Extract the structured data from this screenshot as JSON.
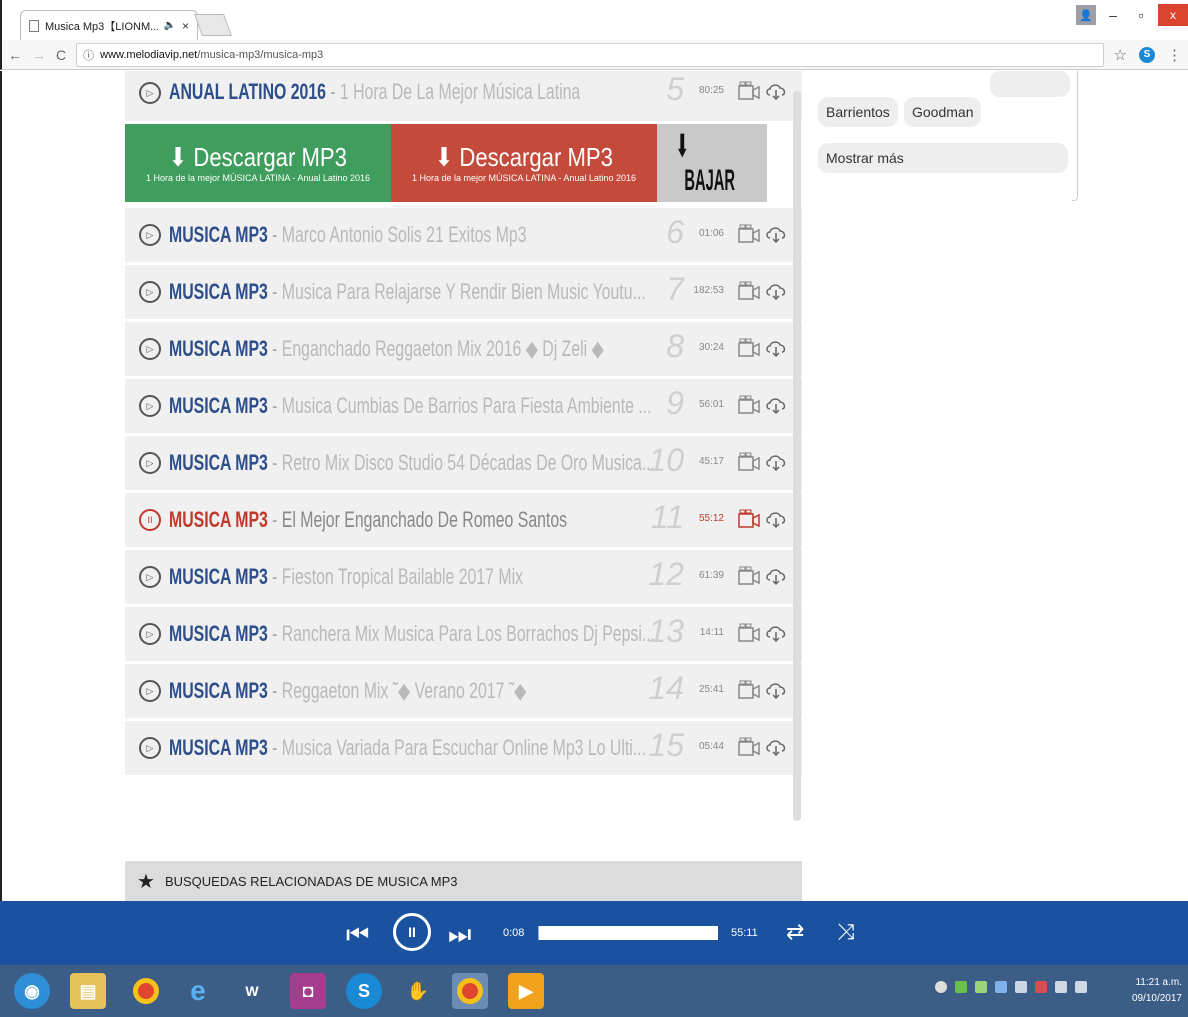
{
  "browser": {
    "tab_title": "Musica Mp3【LIONM...",
    "tab_audio_icon": "speaker-icon",
    "url_domain": "www.melodiavip.net",
    "url_path": "/musica-mp3/musica-mp3"
  },
  "tracks": [
    {
      "artist": "ANUAL LATINO 2016",
      "title": "1 Hora De La Mejor Música Latina",
      "num": "5",
      "duration": "80:25",
      "active": false
    },
    {
      "artist": "MUSICA MP3",
      "title": "Marco Antonio Solis 21 Exitos Mp3",
      "num": "6",
      "duration": "01:06",
      "active": false
    },
    {
      "artist": "MUSICA MP3",
      "title": "Musica Para Relajarse Y Rendir Bien Music Youtu...",
      "num": "7",
      "duration": "182:53",
      "active": false
    },
    {
      "artist": "MUSICA MP3",
      "title": "Enganchado Reggaeton Mix 2016 ◆ Dj Zeli ◆",
      "num": "8",
      "duration": "30:24",
      "active": false
    },
    {
      "artist": "MUSICA MP3",
      "title": "Musica Cumbias De Barrios Para Fiesta Ambiente ...",
      "num": "9",
      "duration": "56:01",
      "active": false
    },
    {
      "artist": "MUSICA MP3",
      "title": "Retro Mix Disco Studio 54 Décadas De Oro Musica...",
      "num": "10",
      "duration": "45:17",
      "active": false
    },
    {
      "artist": "MUSICA MP3",
      "title": "El Mejor Enganchado De Romeo Santos",
      "num": "11",
      "duration": "55:12",
      "active": true
    },
    {
      "artist": "MUSICA MP3",
      "title": "Fieston Tropical Bailable 2017 Mix",
      "num": "12",
      "duration": "61:39",
      "active": false
    },
    {
      "artist": "MUSICA MP3",
      "title": "Ranchera Mix Musica Para Los Borrachos Dj Pepsi...",
      "num": "13",
      "duration": "14:11",
      "active": false
    },
    {
      "artist": "MUSICA MP3",
      "title": "Reggaeton Mix ˜◆ Verano 2017 ˜◆",
      "num": "14",
      "duration": "25:41",
      "active": false
    },
    {
      "artist": "MUSICA MP3",
      "title": "Musica Variada Para Escuchar Online Mp3 Lo Ulti...",
      "num": "15",
      "duration": "05:44",
      "active": false
    }
  ],
  "download": {
    "green_label": "Descargar MP3",
    "green_sub": "1 Hora de la mejor MÚSICA LATINA - Anual Latino 2016",
    "red_label": "Descargar MP3",
    "red_sub": "1 Hora de la mejor MÚSICA LATINA - Anual Latino 2016",
    "bajar_label": "BAJAR"
  },
  "related_title": "BUSQUEDAS RELACIONADAS DE MUSICA MP3",
  "sidebar": {
    "tags": [
      "Barrientos",
      "Goodman"
    ],
    "more_label": "Mostrar más"
  },
  "player": {
    "current_time": "0:08",
    "total_time": "55:11",
    "progress_fraction": 0.0024
  },
  "taskbar": {
    "clock_time": "11:21 a.m.",
    "clock_date": "09/10/2017"
  },
  "colors": {
    "accent_blue": "#2c4e8a",
    "active_red": "#c0392b",
    "download_green": "#3f9d5e",
    "download_red": "#c44b3b",
    "player_blue": "#1a52a0"
  }
}
